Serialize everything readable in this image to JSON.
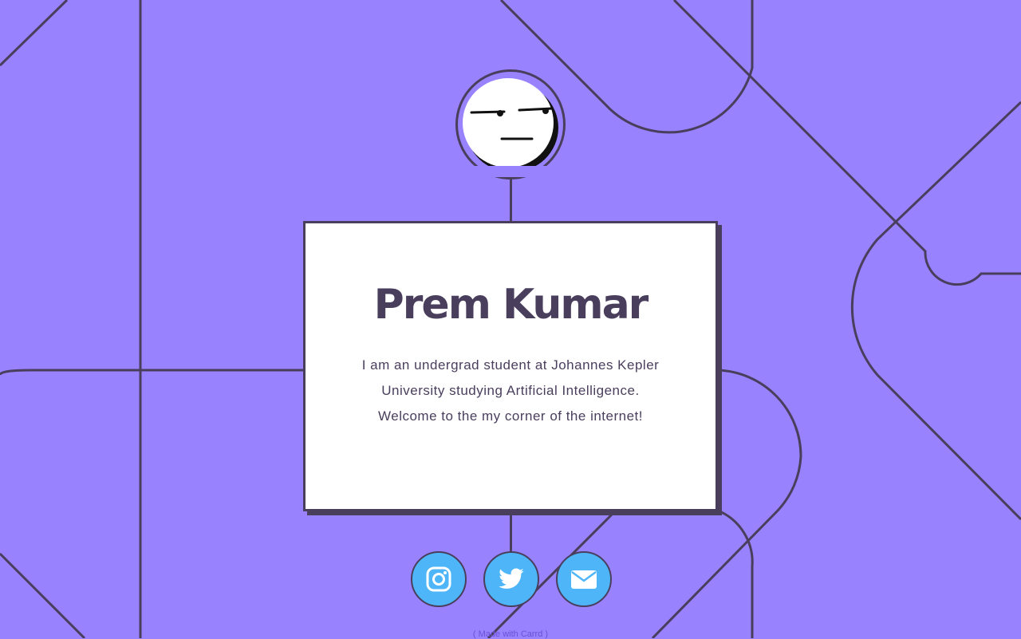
{
  "profile": {
    "name": "Prem Kumar",
    "bio": "I am an undergrad student at Johannes Kepler University studying Artificial Intelligence. Welcome to the my corner of the internet!",
    "avatar_icon": "meh-face-icon"
  },
  "social_links": [
    {
      "icon": "instagram-icon"
    },
    {
      "icon": "twitter-icon"
    },
    {
      "icon": "email-icon"
    }
  ],
  "footer": {
    "credit": "( Made with Carrd )"
  },
  "colors": {
    "background": "#9882fd",
    "line": "#4a3e5d",
    "card": "#ffffff",
    "button": "#4eb6f8",
    "credit": "#6a52d8"
  }
}
